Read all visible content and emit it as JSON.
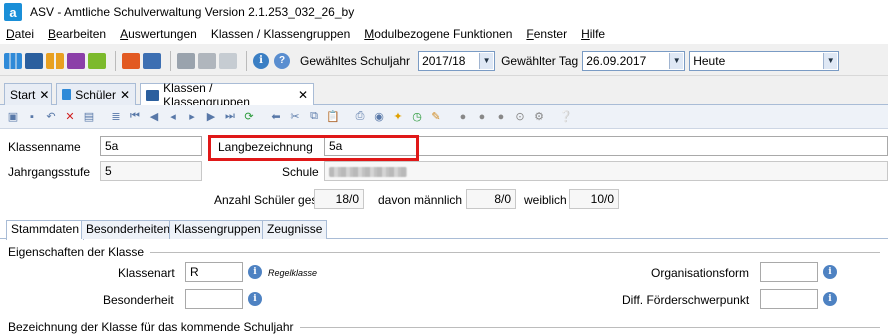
{
  "window": {
    "app_icon_letter": "a",
    "title": "ASV - Amtliche Schulverwaltung Version 2.1.253_032_26_by"
  },
  "menu": [
    {
      "ul": "D",
      "rest": "atei"
    },
    {
      "ul": "B",
      "rest": "earbeiten"
    },
    {
      "ul": "A",
      "rest": "uswertungen"
    },
    {
      "ul": "",
      "rest": "Klassen / Klassengruppen"
    },
    {
      "ul": "M",
      "rest": "odulbezogene Funktionen"
    },
    {
      "ul": "F",
      "rest": "enster"
    },
    {
      "ul": "H",
      "rest": "ilfe"
    }
  ],
  "toolbar": {
    "schuljahr_label": "Gewähltes Schuljahr",
    "schuljahr_value": "2017/18",
    "tag_label": "Gewählter Tag",
    "tag_value": "26.09.2017",
    "heute_value": "Heute"
  },
  "tabs": [
    {
      "label": "Start"
    },
    {
      "label": "Schüler"
    },
    {
      "label": "Klassen / Klassengruppen"
    }
  ],
  "form": {
    "klassenname_label": "Klassenname",
    "klassenname_value": "5a",
    "langbezeichnung_label": "Langbezeichnung",
    "langbezeichnung_value": "5a",
    "jahrgangsstufe_label": "Jahrgangsstufe",
    "jahrgangsstufe_value": "5",
    "schule_label": "Schule",
    "anzahl_label": "Anzahl Schüler ges.",
    "anzahl_value": "18/0",
    "maennlich_label": "davon männlich",
    "maennlich_value": "8/0",
    "weiblich_label": "weiblich",
    "weiblich_value": "10/0"
  },
  "subtabs": [
    "Stammdaten",
    "Besonderheiten",
    "Klassengruppen",
    "Zeugnisse"
  ],
  "section1": {
    "title": "Eigenschaften der Klasse",
    "klassenart_label": "Klassenart",
    "klassenart_value": "R",
    "klassenart_hint": "Regelklasse",
    "besonderheit_label": "Besonderheit",
    "besonderheit_value": "",
    "orgform_label": "Organisationsform",
    "orgform_value": "",
    "foerder_label": "Diff. Förderschwerpunkt",
    "foerder_value": ""
  },
  "section2": {
    "title": "Bezeichnung der Klasse für das kommende Schuljahr"
  },
  "colors": {
    "highlight": "#e01818",
    "accent": "#1a8fd8"
  }
}
